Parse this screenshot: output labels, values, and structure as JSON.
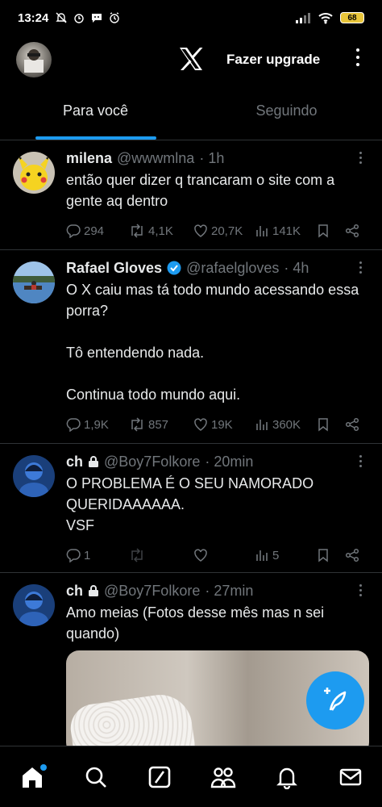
{
  "status_bar": {
    "time": "13:24",
    "battery": "68",
    "icons": [
      "mute-bell-icon",
      "alarm-icon",
      "chat-icon",
      "alarm-clock-icon",
      "signal-icon",
      "wifi-icon",
      "battery-icon"
    ]
  },
  "header": {
    "logo": "x-logo-icon",
    "upgrade_label": "Fazer upgrade"
  },
  "tabs": [
    {
      "label": "Para você",
      "active": true
    },
    {
      "label": "Seguindo",
      "active": false
    }
  ],
  "posts": [
    {
      "name": "milena",
      "handle": "@wwwmlna",
      "time": "· 1h",
      "text": "então quer dizer q trancaram o site com a gente aq dentro",
      "replies": "294",
      "reposts": "4,1K",
      "likes": "20,7K",
      "views": "141K",
      "verified": false,
      "locked": false
    },
    {
      "name": "Rafael Gloves",
      "handle": "@rafaelgloves",
      "time": "· 4h",
      "text": "O X caiu mas tá todo mundo acessando essa porra?\n\nTô entendendo nada.\n\nContinua todo mundo aqui.",
      "replies": "1,9K",
      "reposts": "857",
      "likes": "19K",
      "views": "360K",
      "verified": true,
      "locked": false
    },
    {
      "name": "ch",
      "handle": "@Boy7Folkore",
      "time": "· 20min",
      "text": "O PROBLEMA É O SEU NAMORADO QUERIDAAAAAA.\nVSF",
      "replies": "1",
      "reposts": "",
      "likes": "",
      "views": "5",
      "verified": false,
      "locked": true
    },
    {
      "name": "ch",
      "handle": "@Boy7Folkore",
      "time": "· 27min",
      "text": "Amo meias (Fotos desse mês mas n sei quando)",
      "verified": false,
      "locked": true
    }
  ],
  "colors": {
    "accent": "#1d9bf0",
    "background": "#000000",
    "text": "#e7e9ea",
    "muted": "#71767b",
    "divider": "#2f3336"
  },
  "bottom_nav": [
    "home-icon",
    "search-icon",
    "grok-icon",
    "communities-icon",
    "notifications-icon",
    "messages-icon"
  ]
}
